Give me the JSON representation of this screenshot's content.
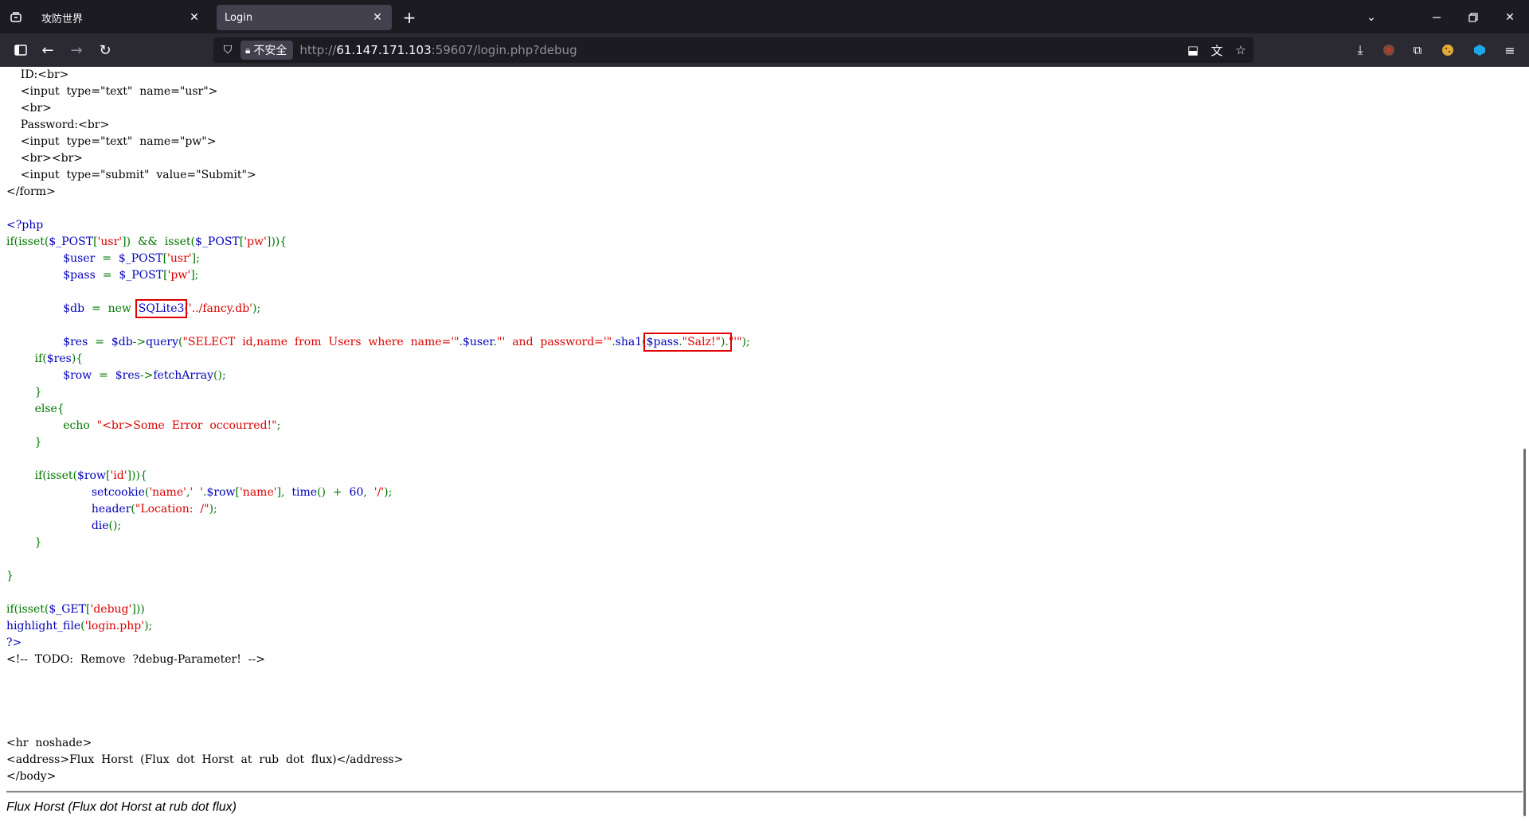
{
  "browser": {
    "tabs": [
      {
        "label": "攻防世界",
        "active": false
      },
      {
        "label": "Login",
        "active": true
      }
    ],
    "url": {
      "security_label": "不安全",
      "scheme": "http://",
      "host": "61.147.171.103",
      "rest": ":59607/login.php?debug"
    }
  },
  "code_lines": [
    [
      {
        "t": "    ID:<br>",
        "c": "html"
      }
    ],
    [
      {
        "t": "    <input  type=\"text\"  name=\"usr\">",
        "c": "html"
      }
    ],
    [
      {
        "t": "    <br>",
        "c": "html"
      }
    ],
    [
      {
        "t": "    Password:<br>",
        "c": "html"
      }
    ],
    [
      {
        "t": "    <input  type=\"text\"  name=\"pw\">",
        "c": "html"
      }
    ],
    [
      {
        "t": "    <br><br>",
        "c": "html"
      }
    ],
    [
      {
        "t": "    <input  type=\"submit\"  value=\"Submit\">",
        "c": "html"
      }
    ],
    [
      {
        "t": "</form>",
        "c": "html"
      }
    ],
    [
      {
        "t": "",
        "c": "html"
      }
    ],
    [
      {
        "t": "<?php",
        "c": "def"
      }
    ],
    [
      {
        "t": "if(isset(",
        "c": "kw"
      },
      {
        "t": "$_POST",
        "c": "def"
      },
      {
        "t": "[",
        "c": "kw"
      },
      {
        "t": "'usr'",
        "c": "str"
      },
      {
        "t": "])  &&  isset(",
        "c": "kw"
      },
      {
        "t": "$_POST",
        "c": "def"
      },
      {
        "t": "[",
        "c": "kw"
      },
      {
        "t": "'pw'",
        "c": "str"
      },
      {
        "t": "])){",
        "c": "kw"
      }
    ],
    [
      {
        "t": "                ",
        "c": "kw"
      },
      {
        "t": "$user  ",
        "c": "def"
      },
      {
        "t": "=  ",
        "c": "kw"
      },
      {
        "t": "$_POST",
        "c": "def"
      },
      {
        "t": "[",
        "c": "kw"
      },
      {
        "t": "'usr'",
        "c": "str"
      },
      {
        "t": "];",
        "c": "kw"
      }
    ],
    [
      {
        "t": "                ",
        "c": "kw"
      },
      {
        "t": "$pass  ",
        "c": "def"
      },
      {
        "t": "=  ",
        "c": "kw"
      },
      {
        "t": "$_POST",
        "c": "def"
      },
      {
        "t": "[",
        "c": "kw"
      },
      {
        "t": "'pw'",
        "c": "str"
      },
      {
        "t": "];",
        "c": "kw"
      }
    ],
    [
      {
        "t": "",
        "c": "kw"
      }
    ],
    [
      {
        "t": "                ",
        "c": "kw"
      },
      {
        "t": "$db  ",
        "c": "def"
      },
      {
        "t": "=  ",
        "c": "kw"
      },
      {
        "t": "new  ",
        "c": "kw"
      },
      {
        "t": "SQLite3",
        "c": "def",
        "box": true
      },
      {
        "t": "(",
        "c": "kw"
      },
      {
        "t": "'../fancy.db'",
        "c": "str"
      },
      {
        "t": ");",
        "c": "kw"
      }
    ],
    [
      {
        "t": "",
        "c": "kw"
      }
    ],
    [
      {
        "t": "                ",
        "c": "kw"
      },
      {
        "t": "$res  ",
        "c": "def"
      },
      {
        "t": "=  ",
        "c": "kw"
      },
      {
        "t": "$db",
        "c": "def"
      },
      {
        "t": "->",
        "c": "kw"
      },
      {
        "t": "query",
        "c": "def"
      },
      {
        "t": "(",
        "c": "kw"
      },
      {
        "t": "\"SELECT  id,name  from  Users  where  name='\"",
        "c": "str"
      },
      {
        "t": ".",
        "c": "kw"
      },
      {
        "t": "$user",
        "c": "def"
      },
      {
        "t": ".",
        "c": "kw"
      },
      {
        "t": "\"'  and  password='\"",
        "c": "str"
      },
      {
        "t": ".",
        "c": "kw"
      },
      {
        "t": "sha1",
        "c": "def"
      },
      {
        "t": "(",
        "c": "kw"
      },
      {
        "t": "$pass",
        "c": "def",
        "box_start": true
      },
      {
        "t": ".",
        "c": "kw",
        "box_mid": true
      },
      {
        "t": "\"Salz!\"",
        "c": "str",
        "box_mid": true
      },
      {
        "t": ").",
        "c": "kw",
        "box_end": true
      },
      {
        "t": "\"'\"",
        "c": "str"
      },
      {
        "t": ");",
        "c": "kw"
      }
    ],
    [
      {
        "t": "        if(",
        "c": "kw"
      },
      {
        "t": "$res",
        "c": "def"
      },
      {
        "t": "){",
        "c": "kw"
      }
    ],
    [
      {
        "t": "                ",
        "c": "kw"
      },
      {
        "t": "$row  ",
        "c": "def"
      },
      {
        "t": "=  ",
        "c": "kw"
      },
      {
        "t": "$res",
        "c": "def"
      },
      {
        "t": "->",
        "c": "kw"
      },
      {
        "t": "fetchArray",
        "c": "def"
      },
      {
        "t": "();",
        "c": "kw"
      }
    ],
    [
      {
        "t": "        }",
        "c": "kw"
      }
    ],
    [
      {
        "t": "        else{",
        "c": "kw"
      }
    ],
    [
      {
        "t": "                echo  ",
        "c": "kw"
      },
      {
        "t": "\"<br>Some  Error  occourred!\"",
        "c": "str"
      },
      {
        "t": ";",
        "c": "kw"
      }
    ],
    [
      {
        "t": "        }",
        "c": "kw"
      }
    ],
    [
      {
        "t": "",
        "c": "kw"
      }
    ],
    [
      {
        "t": "        if(isset(",
        "c": "kw"
      },
      {
        "t": "$row",
        "c": "def"
      },
      {
        "t": "[",
        "c": "kw"
      },
      {
        "t": "'id'",
        "c": "str"
      },
      {
        "t": "])){",
        "c": "kw"
      }
    ],
    [
      {
        "t": "                        ",
        "c": "kw"
      },
      {
        "t": "setcookie",
        "c": "def"
      },
      {
        "t": "(",
        "c": "kw"
      },
      {
        "t": "'name'",
        "c": "str"
      },
      {
        "t": ",",
        "c": "kw"
      },
      {
        "t": "'  '",
        "c": "str"
      },
      {
        "t": ".",
        "c": "kw"
      },
      {
        "t": "$row",
        "c": "def"
      },
      {
        "t": "[",
        "c": "kw"
      },
      {
        "t": "'name'",
        "c": "str"
      },
      {
        "t": "],  ",
        "c": "kw"
      },
      {
        "t": "time",
        "c": "def"
      },
      {
        "t": "()  +  ",
        "c": "kw"
      },
      {
        "t": "60",
        "c": "def"
      },
      {
        "t": ",  ",
        "c": "kw"
      },
      {
        "t": "'/'",
        "c": "str"
      },
      {
        "t": ");",
        "c": "kw"
      }
    ],
    [
      {
        "t": "                        ",
        "c": "kw"
      },
      {
        "t": "header",
        "c": "def"
      },
      {
        "t": "(",
        "c": "kw"
      },
      {
        "t": "\"Location:  /\"",
        "c": "str"
      },
      {
        "t": ");",
        "c": "kw"
      }
    ],
    [
      {
        "t": "                        ",
        "c": "kw"
      },
      {
        "t": "die",
        "c": "def"
      },
      {
        "t": "();",
        "c": "kw"
      }
    ],
    [
      {
        "t": "        }",
        "c": "kw"
      }
    ],
    [
      {
        "t": "",
        "c": "kw"
      }
    ],
    [
      {
        "t": "}",
        "c": "kw"
      }
    ],
    [
      {
        "t": "",
        "c": "kw"
      }
    ],
    [
      {
        "t": "if(isset(",
        "c": "kw"
      },
      {
        "t": "$_GET",
        "c": "def"
      },
      {
        "t": "[",
        "c": "kw"
      },
      {
        "t": "'debug'",
        "c": "str"
      },
      {
        "t": "]))",
        "c": "kw"
      }
    ],
    [
      {
        "t": "highlight_file",
        "c": "def"
      },
      {
        "t": "(",
        "c": "kw"
      },
      {
        "t": "'login.php'",
        "c": "str"
      },
      {
        "t": ");",
        "c": "kw"
      }
    ],
    [
      {
        "t": "?>",
        "c": "def"
      }
    ],
    [
      {
        "t": "<!--  TODO:  Remove  ?debug-Parameter!  -->",
        "c": "html"
      }
    ],
    [
      {
        "t": "",
        "c": "html"
      }
    ],
    [
      {
        "t": "",
        "c": "html"
      }
    ],
    [
      {
        "t": "",
        "c": "html"
      }
    ],
    [
      {
        "t": "",
        "c": "html"
      }
    ],
    [
      {
        "t": "<hr  noshade>",
        "c": "html"
      }
    ],
    [
      {
        "t": "<address>Flux  Horst  (Flux  dot  Horst  at  rub  dot  flux)</address>",
        "c": "html"
      }
    ],
    [
      {
        "t": "</body>",
        "c": "html"
      }
    ]
  ],
  "footer": {
    "address": "Flux Horst (Flux dot Horst at rub dot flux)"
  },
  "colors": {
    "php_keyword": "#007700",
    "php_default": "#0000bb",
    "php_string": "#dd0000",
    "highlight_box": "#e00000",
    "chrome_dark": "#1c1b22",
    "chrome_nav": "#2b2a33"
  }
}
